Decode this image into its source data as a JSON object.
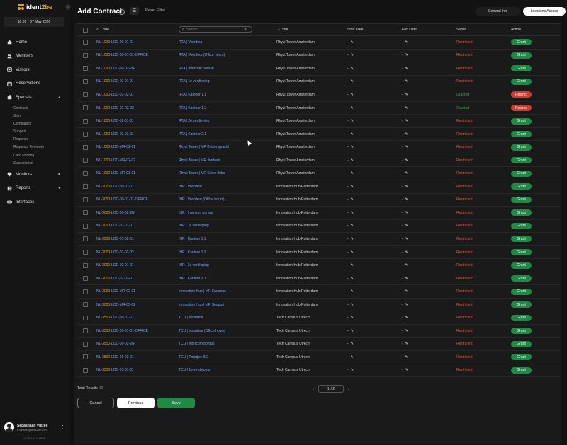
{
  "app": {
    "logo_text_brand": "ident",
    "logo_text_accent": "2be",
    "time": "10:09",
    "date": "07 May 2026",
    "version": "v2.76.1-rc.0-8858"
  },
  "sidebar": {
    "items": [
      {
        "label": "Home",
        "icon": "home-icon"
      },
      {
        "label": "Members",
        "icon": "members-icon"
      },
      {
        "label": "Visitors",
        "icon": "visitors-icon"
      },
      {
        "label": "Reservations",
        "icon": "calendar-icon"
      },
      {
        "label": "Specials",
        "icon": "briefcase-icon",
        "expanded": true
      }
    ],
    "sub_items": [
      "Contracts",
      "Sites",
      "Companies",
      "Support",
      "Requests",
      "Requests Reviewer",
      "Card Printing",
      "Subscription"
    ],
    "items_bottom": [
      {
        "label": "Monitors",
        "icon": "monitor-icon"
      },
      {
        "label": "Reports",
        "icon": "reports-icon"
      },
      {
        "label": "Interfaces",
        "icon": "interfaces-icon"
      }
    ]
  },
  "user": {
    "name": "Sebastiaan Vlezee",
    "email": "s.vlezee@ident2be.com"
  },
  "header": {
    "title": "Add Contract",
    "reset_filter": "Reset Filter",
    "tabs": [
      {
        "label": "General info",
        "active": false
      },
      {
        "label": "Locations Access",
        "active": true
      }
    ]
  },
  "table": {
    "headers": {
      "code": "Code",
      "search_placeholder": "Search",
      "site": "Site",
      "start_date": "Start Date",
      "end_date": "End Date",
      "status": "Status",
      "action": "Action"
    },
    "rows": [
      {
        "code": "NL-1000-LOC-00-01-01",
        "location": "RTA | Voordeur",
        "site": "Rhyzi Tower Amsterdam",
        "start": "-",
        "end": "-",
        "status": "Restricted",
        "action": "Grant"
      },
      {
        "code": "NL-1000-LOC-00-01-01-OFFICE",
        "location": "RTA | Voordeur (Office hours)",
        "site": "Rhyzi Tower Amsterdam",
        "start": "-",
        "end": "-",
        "status": "Restricted",
        "action": "Grant"
      },
      {
        "code": "NL-1000-LOC-00-02-2N",
        "location": "RTA | Intercom portaal",
        "site": "Rhyzi Tower Amsterdam",
        "start": "-",
        "end": "-",
        "status": "Restricted",
        "action": "Grant"
      },
      {
        "code": "NL-1000-LOC-01-01-01",
        "location": "RTA | 1e verdieping",
        "site": "Rhyzi Tower Amsterdam",
        "start": "-",
        "end": "-",
        "status": "Restricted",
        "action": "Grant"
      },
      {
        "code": "NL-1000-LOC-01-02-01",
        "location": "RTA | Kantoor 1.1",
        "site": "Rhyzi Tower Amsterdam",
        "start": "-",
        "end": "-",
        "status": "Granted",
        "action": "Restrict"
      },
      {
        "code": "NL-1000-LOC-01-02-02",
        "location": "RTA | Kantoor 1.2",
        "site": "Rhyzi Tower Amsterdam",
        "start": "-",
        "end": "-",
        "status": "Granted",
        "action": "Restrict"
      },
      {
        "code": "NL-1000-LOC-02-01-01",
        "location": "RTA | 2e verdieping",
        "site": "Rhyzi Tower Amsterdam",
        "start": "-",
        "end": "-",
        "status": "Restricted",
        "action": "Grant"
      },
      {
        "code": "NL-1000-LOC-02-03-01",
        "location": "RTA | Kantoor 2.1",
        "site": "Rhyzi Tower Amsterdam",
        "start": "-",
        "end": "-",
        "status": "Restricted",
        "action": "Grant"
      },
      {
        "code": "NL-1000-LOC-MR-02-01",
        "location": "Rhyzi Tower | MR Keizersgracht",
        "site": "Rhyzi Tower Amsterdam",
        "start": "-",
        "end": "-",
        "status": "Restricted",
        "action": "Grant"
      },
      {
        "code": "NL-1000-LOC-MR-02-02",
        "location": "Rhyzi Tower | MR Jordaan",
        "site": "Rhyzi Tower Amsterdam",
        "start": "-",
        "end": "-",
        "status": "Restricted",
        "action": "Grant"
      },
      {
        "code": "NL-1000-LOC-MR-03-01",
        "location": "Rhyzi Tower | MR Steve Jobs",
        "site": "Rhyzi Tower Amsterdam",
        "start": "-",
        "end": "-",
        "status": "Restricted",
        "action": "Grant"
      },
      {
        "code": "NL-3000-LOC-00-01-01",
        "location": "IHR | Voordeur",
        "site": "Innovation Hub Rotterdam",
        "start": "-",
        "end": "-",
        "status": "Restricted",
        "action": "Grant"
      },
      {
        "code": "NL-3000-LOC-00-01-01-OFFICE",
        "location": "IHR | Voordeur (Office hours)",
        "site": "Innovation Hub Rotterdam",
        "start": "-",
        "end": "-",
        "status": "Restricted",
        "action": "Grant"
      },
      {
        "code": "NL-3000-LOC-00-02-2N",
        "location": "IHR | Intercom portaal",
        "site": "Innovation Hub Rotterdam",
        "start": "-",
        "end": "-",
        "status": "Restricted",
        "action": "Grant"
      },
      {
        "code": "NL-3000-LOC-01-01-01",
        "location": "IHR | 1e verdieping",
        "site": "Innovation Hub Rotterdam",
        "start": "-",
        "end": "-",
        "status": "Restricted",
        "action": "Grant"
      },
      {
        "code": "NL-3000-LOC-01-02-01",
        "location": "IHR | Kantoor 1.1",
        "site": "Innovation Hub Rotterdam",
        "start": "-",
        "end": "-",
        "status": "Restricted",
        "action": "Grant"
      },
      {
        "code": "NL-3000-LOC-01-02-02",
        "location": "IHR | Kantoor 1.2",
        "site": "Innovation Hub Rotterdam",
        "start": "-",
        "end": "-",
        "status": "Restricted",
        "action": "Grant"
      },
      {
        "code": "NL-3000-LOC-02-01-01",
        "location": "IHR | 2e verdieping",
        "site": "Innovation Hub Rotterdam",
        "start": "-",
        "end": "-",
        "status": "Restricted",
        "action": "Grant"
      },
      {
        "code": "NL-3000-LOC-02-03-01",
        "location": "IHR | Kantoor 2.1",
        "site": "Innovation Hub Rotterdam",
        "start": "-",
        "end": "-",
        "status": "Restricted",
        "action": "Grant"
      },
      {
        "code": "NL-3000-LOC-MR-02-01",
        "location": "Innovation Hub | MR Erasmus",
        "site": "Innovation Hub Rotterdam",
        "start": "-",
        "end": "-",
        "status": "Restricted",
        "action": "Grant"
      },
      {
        "code": "NL-3000-LOC-MR-03-02",
        "location": "Innovation Hub | MR Seaport",
        "site": "Innovation Hub Rotterdam",
        "start": "-",
        "end": "-",
        "status": "Restricted",
        "action": "Grant"
      },
      {
        "code": "NL-3500-LOC-00-01-01",
        "location": "TCU | Voordeur",
        "site": "Tech Campus Utrecht",
        "start": "-",
        "end": "-",
        "status": "Restricted",
        "action": "Grant"
      },
      {
        "code": "NL-3500-LOC-00-01-01-OFFICE",
        "location": "TCU | Voordeur (Office hours)",
        "site": "Tech Campus Utrecht",
        "start": "-",
        "end": "-",
        "status": "Restricted",
        "action": "Grant"
      },
      {
        "code": "NL-3500-LOC-00-02-2N",
        "location": "TCU | Intercom portaal",
        "site": "Tech Campus Utrecht",
        "start": "-",
        "end": "-",
        "status": "Restricted",
        "action": "Grant"
      },
      {
        "code": "NL-3500-LOC-00-03-01",
        "location": "TCU | Poortjes BG",
        "site": "Tech Campus Utrecht",
        "start": "-",
        "end": "-",
        "status": "Restricted",
        "action": "Grant"
      },
      {
        "code": "NL-3500-LOC-01-01-01",
        "location": "TCU | 1e verdieping",
        "site": "Tech Campus Utrecht",
        "start": "-",
        "end": "-",
        "status": "Restricted",
        "action": "Grant"
      }
    ]
  },
  "footer": {
    "total_label": "Total Results",
    "total_value": "43",
    "page_current": "1",
    "page_total": "/ 2",
    "cancel": "Cancel",
    "previous": "Previous",
    "save": "Save"
  },
  "colors": {
    "grant": "#1f8a45",
    "restrict": "#d03a33",
    "restricted_text": "#e44e47",
    "granted_text": "#2aa557",
    "brand": "#e2a22a",
    "link": "#7aa4ff"
  }
}
